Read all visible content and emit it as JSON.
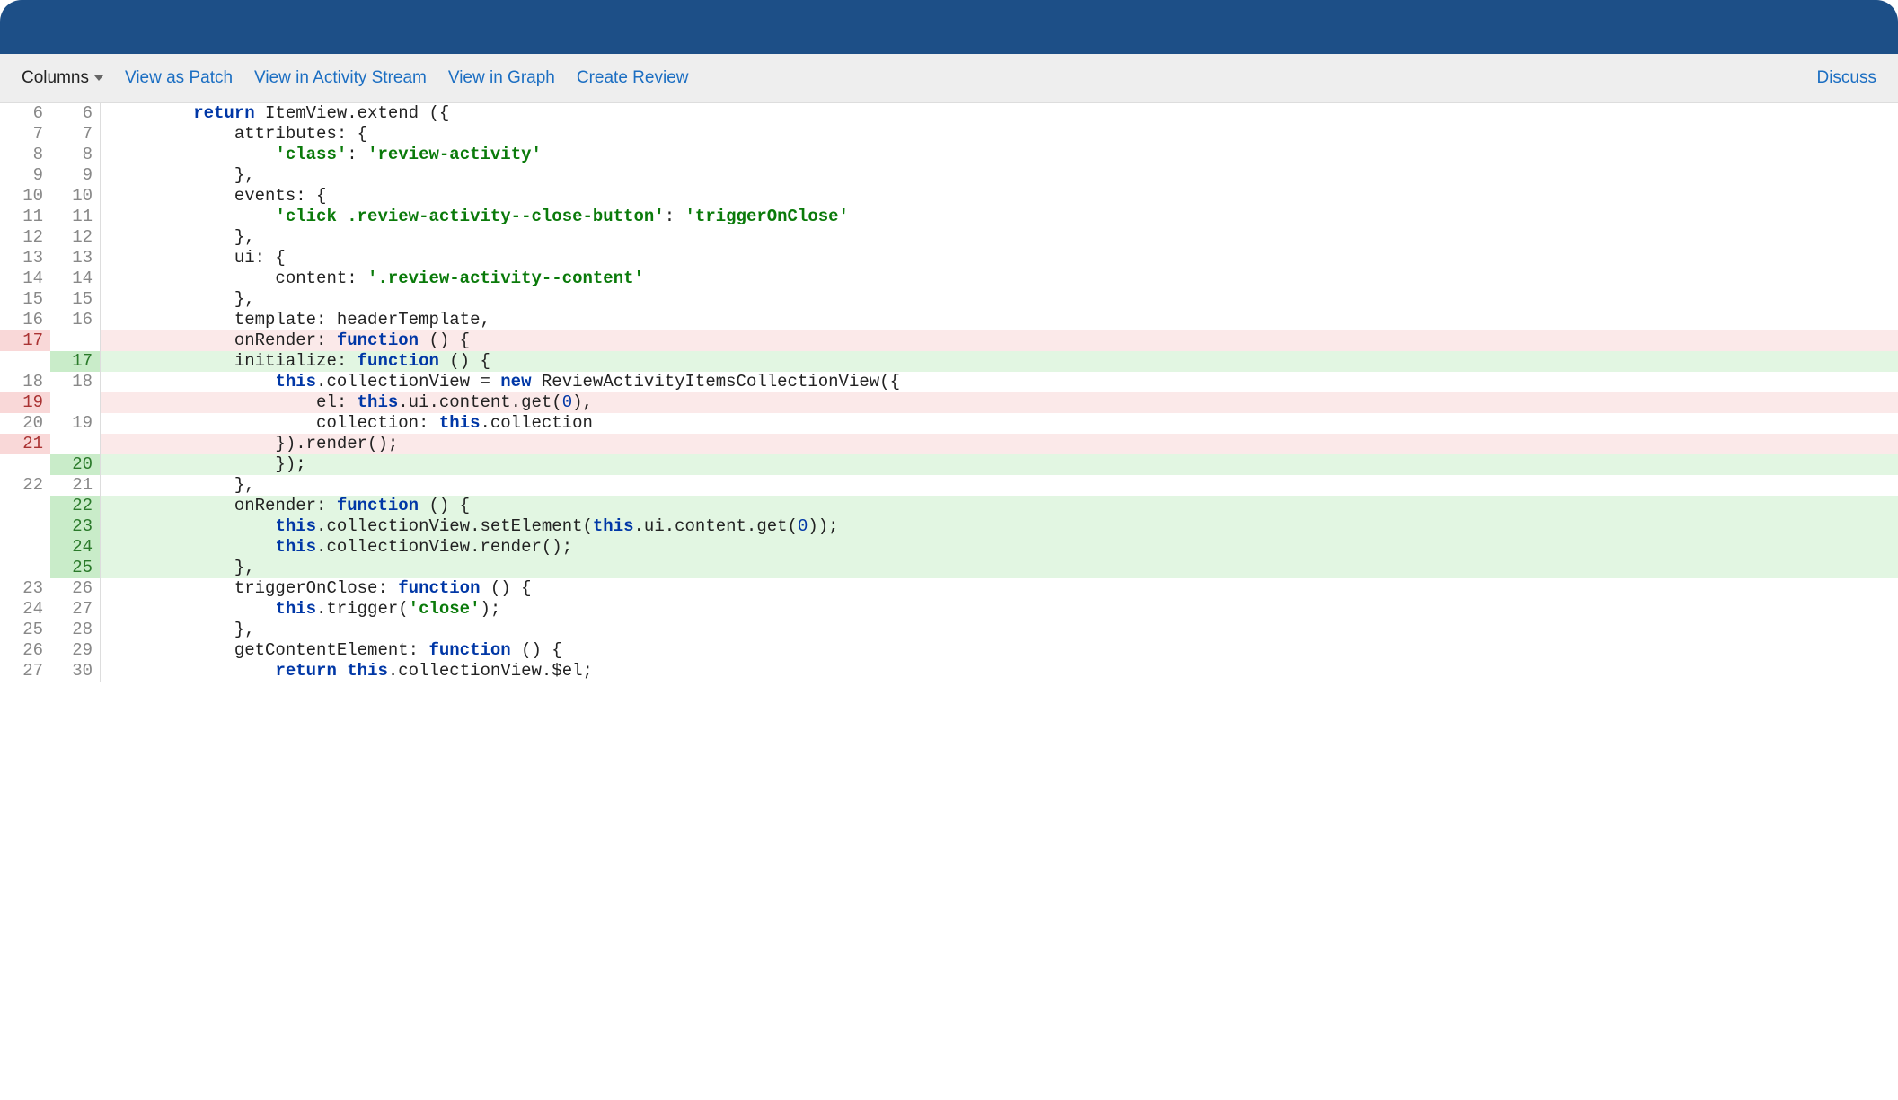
{
  "toolbar": {
    "columns_label": "Columns",
    "links": [
      "View as Patch",
      "View in Activity Stream",
      "View in Graph",
      "Create Review"
    ],
    "discuss_label": "Discuss"
  },
  "diff": {
    "rows": [
      {
        "type": "ctx",
        "old": "6",
        "new": "6",
        "segments": [
          {
            "c": "plain",
            "t": "        "
          },
          {
            "c": "kw",
            "t": "return"
          },
          {
            "c": "plain",
            "t": " ItemView.extend ({"
          }
        ]
      },
      {
        "type": "ctx",
        "old": "7",
        "new": "7",
        "segments": [
          {
            "c": "plain",
            "t": "            attributes: {"
          }
        ]
      },
      {
        "type": "ctx",
        "old": "8",
        "new": "8",
        "segments": [
          {
            "c": "plain",
            "t": "                "
          },
          {
            "c": "str",
            "t": "'class'"
          },
          {
            "c": "plain",
            "t": ": "
          },
          {
            "c": "str",
            "t": "'review-activity'"
          }
        ]
      },
      {
        "type": "ctx",
        "old": "9",
        "new": "9",
        "segments": [
          {
            "c": "plain",
            "t": "            },"
          }
        ]
      },
      {
        "type": "ctx",
        "old": "10",
        "new": "10",
        "segments": [
          {
            "c": "plain",
            "t": "            events: {"
          }
        ]
      },
      {
        "type": "ctx",
        "old": "11",
        "new": "11",
        "segments": [
          {
            "c": "plain",
            "t": "                "
          },
          {
            "c": "str",
            "t": "'click .review-activity--close-button'"
          },
          {
            "c": "plain",
            "t": ": "
          },
          {
            "c": "str",
            "t": "'triggerOnClose'"
          }
        ]
      },
      {
        "type": "ctx",
        "old": "12",
        "new": "12",
        "segments": [
          {
            "c": "plain",
            "t": "            },"
          }
        ]
      },
      {
        "type": "ctx",
        "old": "13",
        "new": "13",
        "segments": [
          {
            "c": "plain",
            "t": "            ui: {"
          }
        ]
      },
      {
        "type": "ctx",
        "old": "14",
        "new": "14",
        "segments": [
          {
            "c": "plain",
            "t": "                content: "
          },
          {
            "c": "str",
            "t": "'.review-activity--content'"
          }
        ]
      },
      {
        "type": "ctx",
        "old": "15",
        "new": "15",
        "segments": [
          {
            "c": "plain",
            "t": "            },"
          }
        ]
      },
      {
        "type": "ctx",
        "old": "16",
        "new": "16",
        "segments": [
          {
            "c": "plain",
            "t": "            template: headerTemplate,"
          }
        ]
      },
      {
        "type": "del",
        "old": "17",
        "new": "",
        "segments": [
          {
            "c": "plain",
            "t": "            onRender: "
          },
          {
            "c": "kw",
            "t": "function"
          },
          {
            "c": "plain",
            "t": " () {"
          }
        ]
      },
      {
        "type": "add",
        "old": "",
        "new": "17",
        "segments": [
          {
            "c": "plain",
            "t": "            initialize: "
          },
          {
            "c": "kw",
            "t": "function"
          },
          {
            "c": "plain",
            "t": " () {"
          }
        ]
      },
      {
        "type": "ctx",
        "old": "18",
        "new": "18",
        "segments": [
          {
            "c": "plain",
            "t": "                "
          },
          {
            "c": "kw",
            "t": "this"
          },
          {
            "c": "plain",
            "t": ".collectionView = "
          },
          {
            "c": "kw",
            "t": "new"
          },
          {
            "c": "plain",
            "t": " ReviewActivityItemsCollectionView({"
          }
        ]
      },
      {
        "type": "del",
        "old": "19",
        "new": "",
        "segments": [
          {
            "c": "plain",
            "t": "                    el: "
          },
          {
            "c": "kw",
            "t": "this"
          },
          {
            "c": "plain",
            "t": ".ui.content.get("
          },
          {
            "c": "num",
            "t": "0"
          },
          {
            "c": "plain",
            "t": "),"
          }
        ]
      },
      {
        "type": "ctx",
        "old": "20",
        "new": "19",
        "segments": [
          {
            "c": "plain",
            "t": "                    collection: "
          },
          {
            "c": "kw",
            "t": "this"
          },
          {
            "c": "plain",
            "t": ".collection"
          }
        ]
      },
      {
        "type": "del",
        "old": "21",
        "new": "",
        "segments": [
          {
            "c": "plain",
            "t": "                }).render();"
          }
        ]
      },
      {
        "type": "add",
        "old": "",
        "new": "20",
        "segments": [
          {
            "c": "plain",
            "t": "                });"
          }
        ]
      },
      {
        "type": "ctx",
        "old": "22",
        "new": "21",
        "segments": [
          {
            "c": "plain",
            "t": "            },"
          }
        ]
      },
      {
        "type": "add",
        "old": "",
        "new": "22",
        "segments": [
          {
            "c": "plain",
            "t": "            onRender: "
          },
          {
            "c": "kw",
            "t": "function"
          },
          {
            "c": "plain",
            "t": " () {"
          }
        ]
      },
      {
        "type": "add",
        "old": "",
        "new": "23",
        "segments": [
          {
            "c": "plain",
            "t": "                "
          },
          {
            "c": "kw",
            "t": "this"
          },
          {
            "c": "plain",
            "t": ".collectionView.setElement("
          },
          {
            "c": "kw",
            "t": "this"
          },
          {
            "c": "plain",
            "t": ".ui.content.get("
          },
          {
            "c": "num",
            "t": "0"
          },
          {
            "c": "plain",
            "t": "));"
          }
        ]
      },
      {
        "type": "add",
        "old": "",
        "new": "24",
        "segments": [
          {
            "c": "plain",
            "t": "                "
          },
          {
            "c": "kw",
            "t": "this"
          },
          {
            "c": "plain",
            "t": ".collectionView.render();"
          }
        ]
      },
      {
        "type": "add",
        "old": "",
        "new": "25",
        "segments": [
          {
            "c": "plain",
            "t": "            },"
          }
        ]
      },
      {
        "type": "ctx",
        "old": "23",
        "new": "26",
        "segments": [
          {
            "c": "plain",
            "t": "            triggerOnClose: "
          },
          {
            "c": "kw",
            "t": "function"
          },
          {
            "c": "plain",
            "t": " () {"
          }
        ]
      },
      {
        "type": "ctx",
        "old": "24",
        "new": "27",
        "segments": [
          {
            "c": "plain",
            "t": "                "
          },
          {
            "c": "kw",
            "t": "this"
          },
          {
            "c": "plain",
            "t": ".trigger("
          },
          {
            "c": "str",
            "t": "'close'"
          },
          {
            "c": "plain",
            "t": ");"
          }
        ]
      },
      {
        "type": "ctx",
        "old": "25",
        "new": "28",
        "segments": [
          {
            "c": "plain",
            "t": "            },"
          }
        ]
      },
      {
        "type": "ctx",
        "old": "26",
        "new": "29",
        "segments": [
          {
            "c": "plain",
            "t": "            getContentElement: "
          },
          {
            "c": "kw",
            "t": "function"
          },
          {
            "c": "plain",
            "t": " () {"
          }
        ]
      },
      {
        "type": "ctx",
        "old": "27",
        "new": "30",
        "segments": [
          {
            "c": "plain",
            "t": "                "
          },
          {
            "c": "kw",
            "t": "return"
          },
          {
            "c": "plain",
            "t": " "
          },
          {
            "c": "kw",
            "t": "this"
          },
          {
            "c": "plain",
            "t": ".collectionView.$el;"
          }
        ]
      }
    ]
  }
}
